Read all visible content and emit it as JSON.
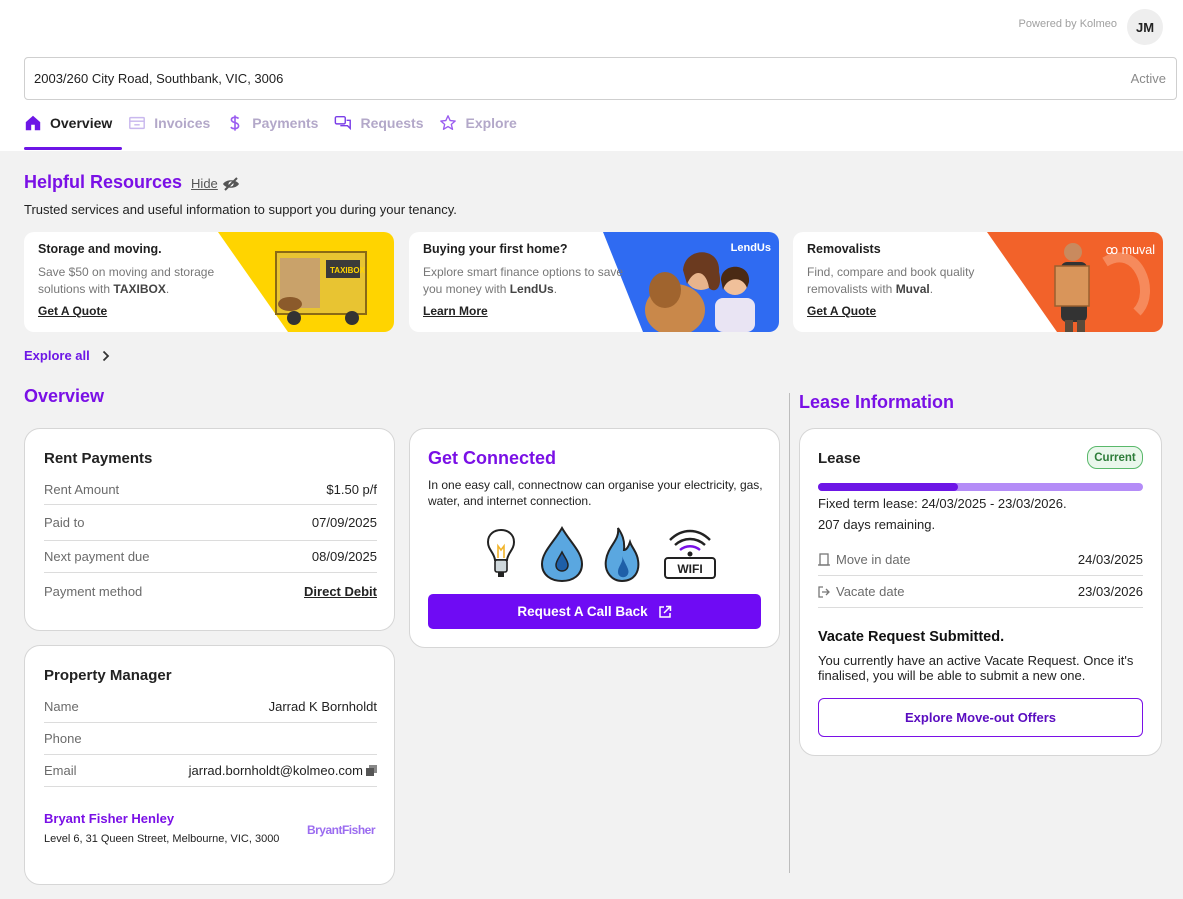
{
  "header": {
    "powered_by": "Powered by Kolmeo",
    "avatar_initials": "JM"
  },
  "property": {
    "address": "2003/260 City Road, Southbank, VIC, 3006",
    "status": "Active"
  },
  "tabs": [
    {
      "label": "Overview",
      "icon": "home-icon",
      "active": true
    },
    {
      "label": "Invoices",
      "icon": "invoice-icon",
      "active": false
    },
    {
      "label": "Payments",
      "icon": "dollar-icon",
      "active": false
    },
    {
      "label": "Requests",
      "icon": "chat-icon",
      "active": false
    },
    {
      "label": "Explore",
      "icon": "star-icon",
      "active": false
    }
  ],
  "helpful": {
    "title": "Helpful Resources",
    "hide_label": "Hide",
    "subtitle": "Trusted services and useful information to support you during your tenancy.",
    "explore_all": "Explore all",
    "cards": [
      {
        "title": "Storage and moving.",
        "desc_pre": "Save $50 on moving and storage solutions with ",
        "brand": "TAXIBOX",
        "desc_post": ".",
        "link": "Get A Quote",
        "accent": "#ffd400"
      },
      {
        "title": "Buying your first home?",
        "desc_pre": "Explore smart finance options to save you money with ",
        "brand": "LendUs",
        "desc_post": ".",
        "link": "Learn More",
        "accent": "#2f6bf2",
        "tag": "LendUs"
      },
      {
        "title": "Removalists",
        "desc_pre": "Find, compare and book quality removalists with ",
        "brand": "Muval",
        "desc_post": ".",
        "link": "Get A Quote",
        "accent": "#f2622a",
        "tag": "muval"
      }
    ]
  },
  "overview": {
    "title": "Overview",
    "rent": {
      "title": "Rent Payments",
      "rows": [
        {
          "k": "Rent Amount",
          "v": "$1.50 p/f"
        },
        {
          "k": "Paid to",
          "v": "07/09/2025"
        },
        {
          "k": "Next payment due",
          "v": "08/09/2025"
        },
        {
          "k": "Payment method",
          "v": "Direct Debit"
        }
      ]
    },
    "connected": {
      "title": "Get Connected",
      "desc": "In one easy call, connectnow can organise your electricity, gas, water, and internet connection.",
      "wifi_label": "WIFI",
      "button": "Request A Call Back"
    },
    "manager": {
      "title": "Property Manager",
      "rows": [
        {
          "k": "Name",
          "v": "Jarrad K Bornholdt"
        },
        {
          "k": "Phone",
          "v": ""
        },
        {
          "k": "Email",
          "v": "jarrad.bornholdt@kolmeo.com"
        }
      ],
      "agency_name": "Bryant Fisher Henley",
      "agency_address": "Level 6, 31 Queen Street, Melbourne, VIC, 3000",
      "agency_logo": "BryantFisher"
    }
  },
  "lease": {
    "section_title": "Lease Information",
    "title": "Lease",
    "badge": "Current",
    "progress": 0.43,
    "term": "Fixed term lease: 24/03/2025 - 23/03/2026.",
    "remaining": "207 days remaining.",
    "rows": [
      {
        "k": "Move in date",
        "v": "24/03/2025",
        "icon": "door-icon"
      },
      {
        "k": "Vacate date",
        "v": "23/03/2026",
        "icon": "exit-icon"
      }
    ],
    "vacate_title": "Vacate Request Submitted.",
    "vacate_text": "You currently have an active Vacate Request. Once it's finalised, you will be able to submit a new one.",
    "button": "Explore Move-out Offers"
  }
}
